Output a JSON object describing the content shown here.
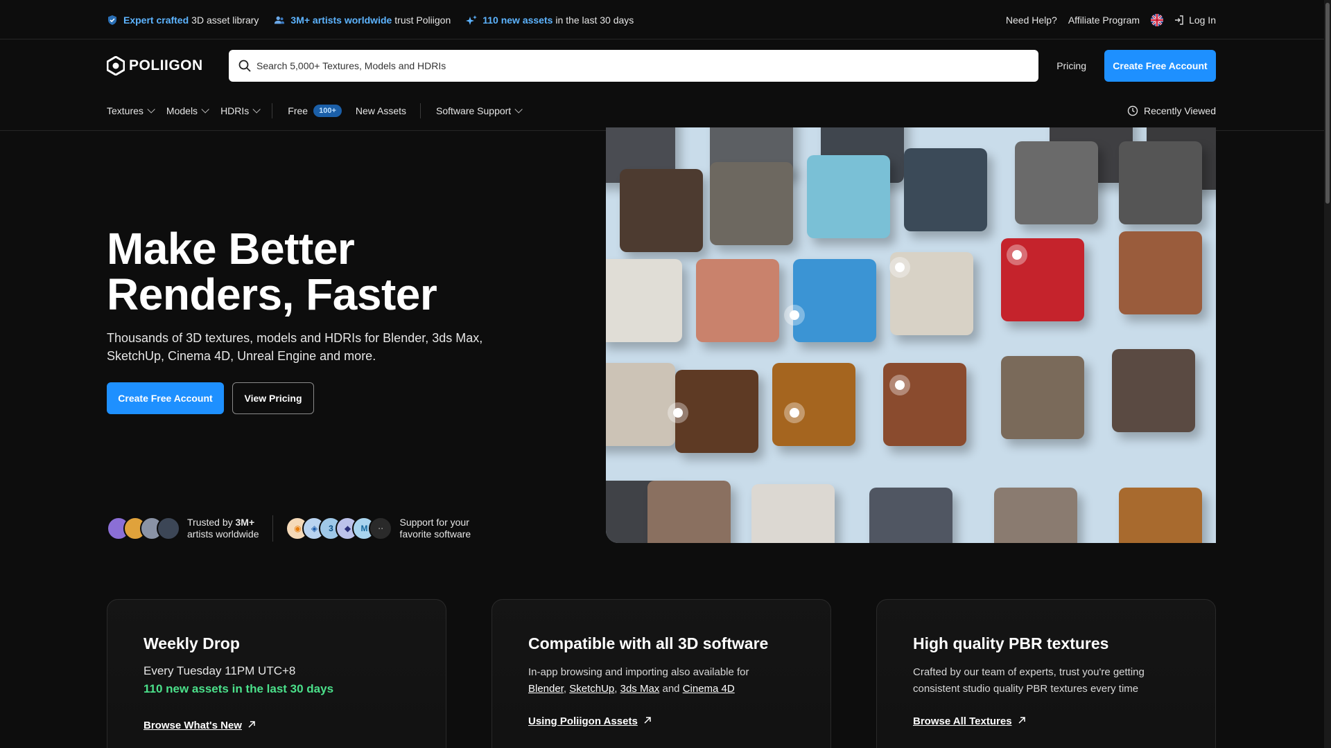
{
  "topbar": {
    "items": [
      {
        "highlight": "Expert crafted",
        "text": "3D asset library",
        "icon": "shield-check-icon"
      },
      {
        "highlight": "3M+ artists worldwide",
        "text": "trust Poliigon",
        "icon": "users-icon"
      },
      {
        "highlight": "110 new assets",
        "text": "in the last 30 days",
        "icon": "sparkle-icon"
      }
    ],
    "need_help": "Need Help?",
    "affiliate": "Affiliate Program",
    "login": "Log In"
  },
  "header": {
    "logo": "POLIIGON",
    "search_placeholder": "Search 5,000+ Textures, Models and HDRIs",
    "pricing": "Pricing",
    "cta": "Create Free Account"
  },
  "nav": {
    "textures": "Textures",
    "models": "Models",
    "hdris": "HDRIs",
    "free": "Free",
    "free_badge": "100+",
    "new_assets": "New Assets",
    "software_support": "Software Support",
    "recently_viewed": "Recently Viewed"
  },
  "hero": {
    "title_line1": "Make Better",
    "title_line2": "Renders, Faster",
    "subtitle": "Thousands of 3D textures, models and HDRIs for Blender, 3ds Max, SketchUp, Cinema 4D, Unreal Engine and more.",
    "cta_primary": "Create Free Account",
    "cta_secondary": "View Pricing",
    "trust_line1_prefix": "Trusted by ",
    "trust_line1_bold": "3M+",
    "trust_line2": "artists worldwide",
    "support_line1": "Support for your",
    "support_line2": "favorite software"
  },
  "cards": {
    "weekly": {
      "title": "Weekly Drop",
      "line1": "Every Tuesday 11PM UTC+8",
      "green": "110 new assets in the last 30 days",
      "link": "Browse What's New"
    },
    "compat": {
      "title": "Compatible with all 3D software",
      "text_before": "In-app browsing and importing also available for",
      "blender": "Blender",
      "sketchup": "SketchUp",
      "max": "3ds Max",
      "and": "and",
      "c4d": "Cinema 4D",
      "link": "Using Poliigon Assets"
    },
    "pbr": {
      "title": "High quality PBR textures",
      "text": "Crafted by our team of experts, trust you're getting consistent studio quality PBR textures every time",
      "link": "Browse All Textures"
    }
  },
  "colors": {
    "accent": "#1e90ff",
    "highlight_blue": "#5db4ff",
    "green": "#4be08a",
    "background": "#0d0d0d"
  }
}
